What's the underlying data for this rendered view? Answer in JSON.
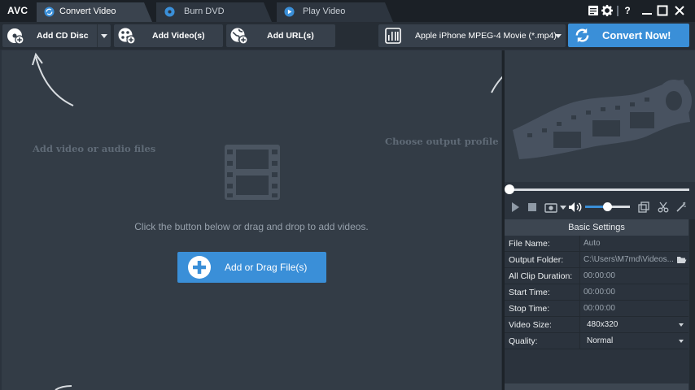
{
  "app": {
    "brand": "AVC"
  },
  "tabs": [
    {
      "label": "Convert Video",
      "active": true,
      "icon": "refresh-icon"
    },
    {
      "label": "Burn DVD",
      "active": false,
      "icon": "disc-icon"
    },
    {
      "label": "Play Video",
      "active": false,
      "icon": "play-circle-icon"
    }
  ],
  "window_controls": {
    "help": "?"
  },
  "toolbar": {
    "add_cd": "Add CD Disc",
    "add_videos": "Add Video(s)",
    "add_url": "Add URL(s)",
    "profile": "Apple iPhone MPEG-4 Movie (*.mp4)",
    "convert": "Convert Now!"
  },
  "main": {
    "hint_add": "Add video or audio files",
    "hint_profile": "Choose output profile and convert",
    "drop_text": "Click the button below or drag and drop to add videos.",
    "add_button": "Add or Drag File(s)"
  },
  "player": {
    "seek_position": 0.0,
    "volume_level": 0.45
  },
  "settings": {
    "title": "Basic Settings",
    "rows": [
      {
        "label": "File Name:",
        "value": "Auto"
      },
      {
        "label": "Output Folder:",
        "value": "C:\\Users\\M7md\\Videos..."
      },
      {
        "label": "All Clip Duration:",
        "value": "00:00:00"
      },
      {
        "label": "Start Time:",
        "value": "00:00:00"
      },
      {
        "label": "Stop Time:",
        "value": "00:00:00"
      },
      {
        "label": "Video Size:",
        "value": "480x320"
      },
      {
        "label": "Quality:",
        "value": "Normal"
      }
    ]
  },
  "colors": {
    "accent": "#3a8fd8",
    "background": "#2b333d",
    "titlebar": "#1b2026"
  }
}
